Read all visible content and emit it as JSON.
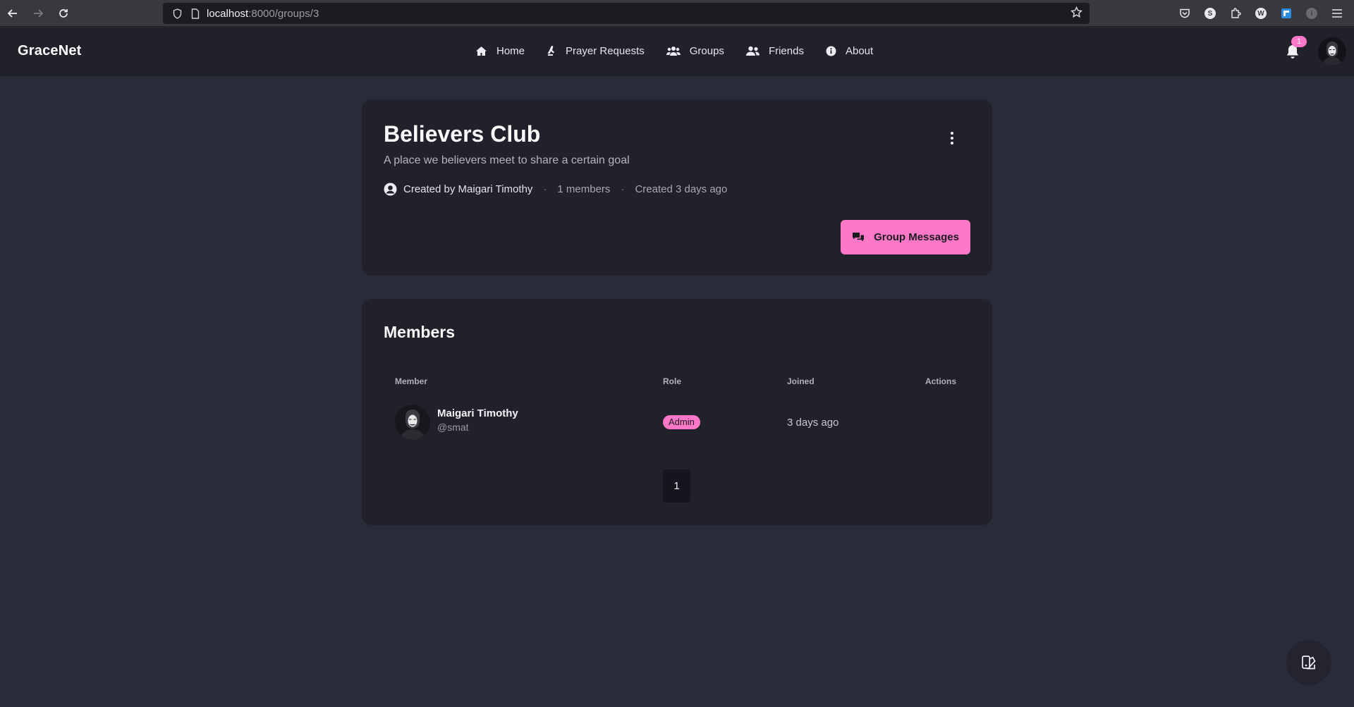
{
  "browser": {
    "url_host": "localhost",
    "url_path": ":8000/groups/3"
  },
  "navbar": {
    "brand": "GraceNet",
    "links": [
      {
        "label": "Home",
        "icon": "home-icon"
      },
      {
        "label": "Prayer Requests",
        "icon": "praying-hands-icon"
      },
      {
        "label": "Groups",
        "icon": "users-icon"
      },
      {
        "label": "Friends",
        "icon": "user-friends-icon"
      },
      {
        "label": "About",
        "icon": "info-icon"
      }
    ],
    "notification_count": "1"
  },
  "group": {
    "title": "Believers Club",
    "description": "A place we believers meet to share a certain goal",
    "created_by": "Created by Maigari Timothy",
    "members_count": "1 members",
    "created_at": "Created 3 days ago",
    "messages_button": "Group Messages"
  },
  "members": {
    "title": "Members",
    "columns": [
      "Member",
      "Role",
      "Joined",
      "Actions"
    ],
    "rows": [
      {
        "name": "Maigari Timothy",
        "handle": "@smat",
        "role": "Admin",
        "joined": "3 days ago"
      }
    ],
    "page": "1"
  },
  "colors": {
    "accent": "#ff78c8",
    "background": "#2a2b38",
    "card": "#20212b"
  }
}
